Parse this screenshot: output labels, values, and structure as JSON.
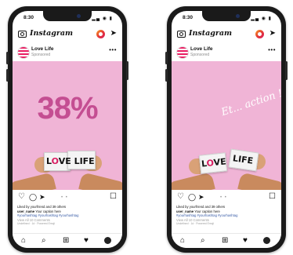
{
  "phones": [
    {
      "status_time": "8:30",
      "status_icons": "▂▄ ◉ ▮",
      "app_logo": "Instagram",
      "account_name": "Love Life",
      "account_sub": "Sponsored",
      "more": "•••",
      "media_text": "38%",
      "card_left": "L",
      "card_o": "O",
      "card_mid": "VE",
      "card_right": "LIFE",
      "caption": {
        "likes": "Liked by yourfriend and 39 others",
        "user": "user_name",
        "caption": " Your caption here",
        "tags": "#yourhashtag #yourhashtag #yourhashtag",
        "comments": "View All 10 Comments",
        "meta": "Undefined · 1d · Powered Emoji"
      }
    },
    {
      "status_time": "8:30",
      "status_icons": "▂▄ ◉ ▮",
      "app_logo": "Instagram",
      "account_name": "Love Life",
      "account_sub": "Sponsored",
      "more": "•••",
      "media_text": "Et... action !",
      "card_left": "L",
      "card_o": "O",
      "card_mid": "VE",
      "card_right": "LIFE",
      "caption": {
        "likes": "Liked by yourfriend and 39 others",
        "user": "user_name",
        "caption": " Your caption here",
        "tags": "#yourhashtag #yourhashtag #yourhashtag",
        "comments": "View All 10 Comments",
        "meta": "Undefined · 1d · Powered Emoji"
      }
    }
  ],
  "icons": {
    "heart": "♡",
    "comment": "◯",
    "send": "➤",
    "save": "☐",
    "home": "⌂",
    "search": "⌕",
    "add": "⊞",
    "likes_nav": "♥",
    "carousel_dots": "• •"
  },
  "colors": {
    "media_pink": "#f0b4d6",
    "stat_magenta": "#c44e92",
    "brand_red": "#d81b60",
    "hashtag_blue": "#3b5ea8"
  }
}
